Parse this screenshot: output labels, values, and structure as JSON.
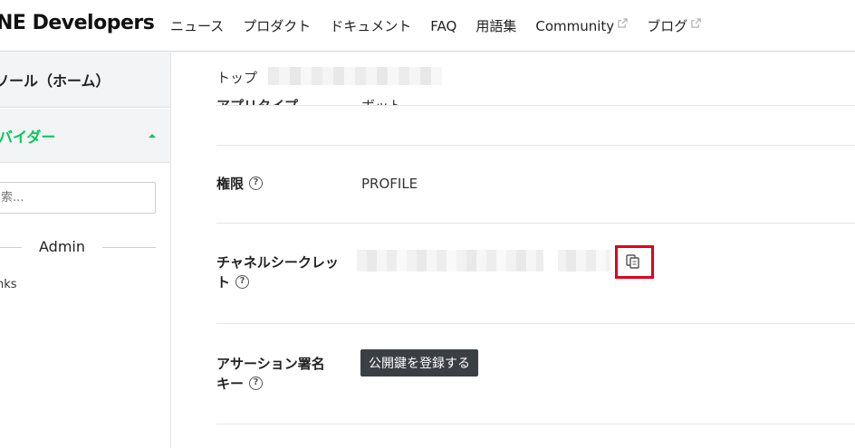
{
  "header": {
    "logo_text": "NE  Developers",
    "nav": [
      {
        "label": "ニュース",
        "external": false
      },
      {
        "label": "プロダクト",
        "external": false
      },
      {
        "label": "ドキュメント",
        "external": false
      },
      {
        "label": "FAQ",
        "external": false
      },
      {
        "label": "用語集",
        "external": false
      },
      {
        "label": "Community",
        "external": true
      },
      {
        "label": "ブログ",
        "external": true
      }
    ]
  },
  "sidebar": {
    "console_label": "ソール（ホーム）",
    "provider_label": "バイダー",
    "search_placeholder": "索...",
    "section_heading": "Admin",
    "links_label": "nks"
  },
  "main": {
    "breadcrumb": "トップ",
    "partial_row": {
      "label": "アプリタイプ",
      "value": "ボット"
    },
    "permission": {
      "label": "権限",
      "value": "PROFILE"
    },
    "channel_secret": {
      "label_line1": "チャネルシークレッ",
      "label_line2": "ト"
    },
    "assertion_key": {
      "label_line1": "アサーション署名",
      "label_line2": "キー",
      "button_label": "公開鍵を登録する"
    }
  },
  "colors": {
    "accent_green": "#06c755",
    "highlight_red": "#e0001b",
    "dark_button": "#3a3f44"
  }
}
